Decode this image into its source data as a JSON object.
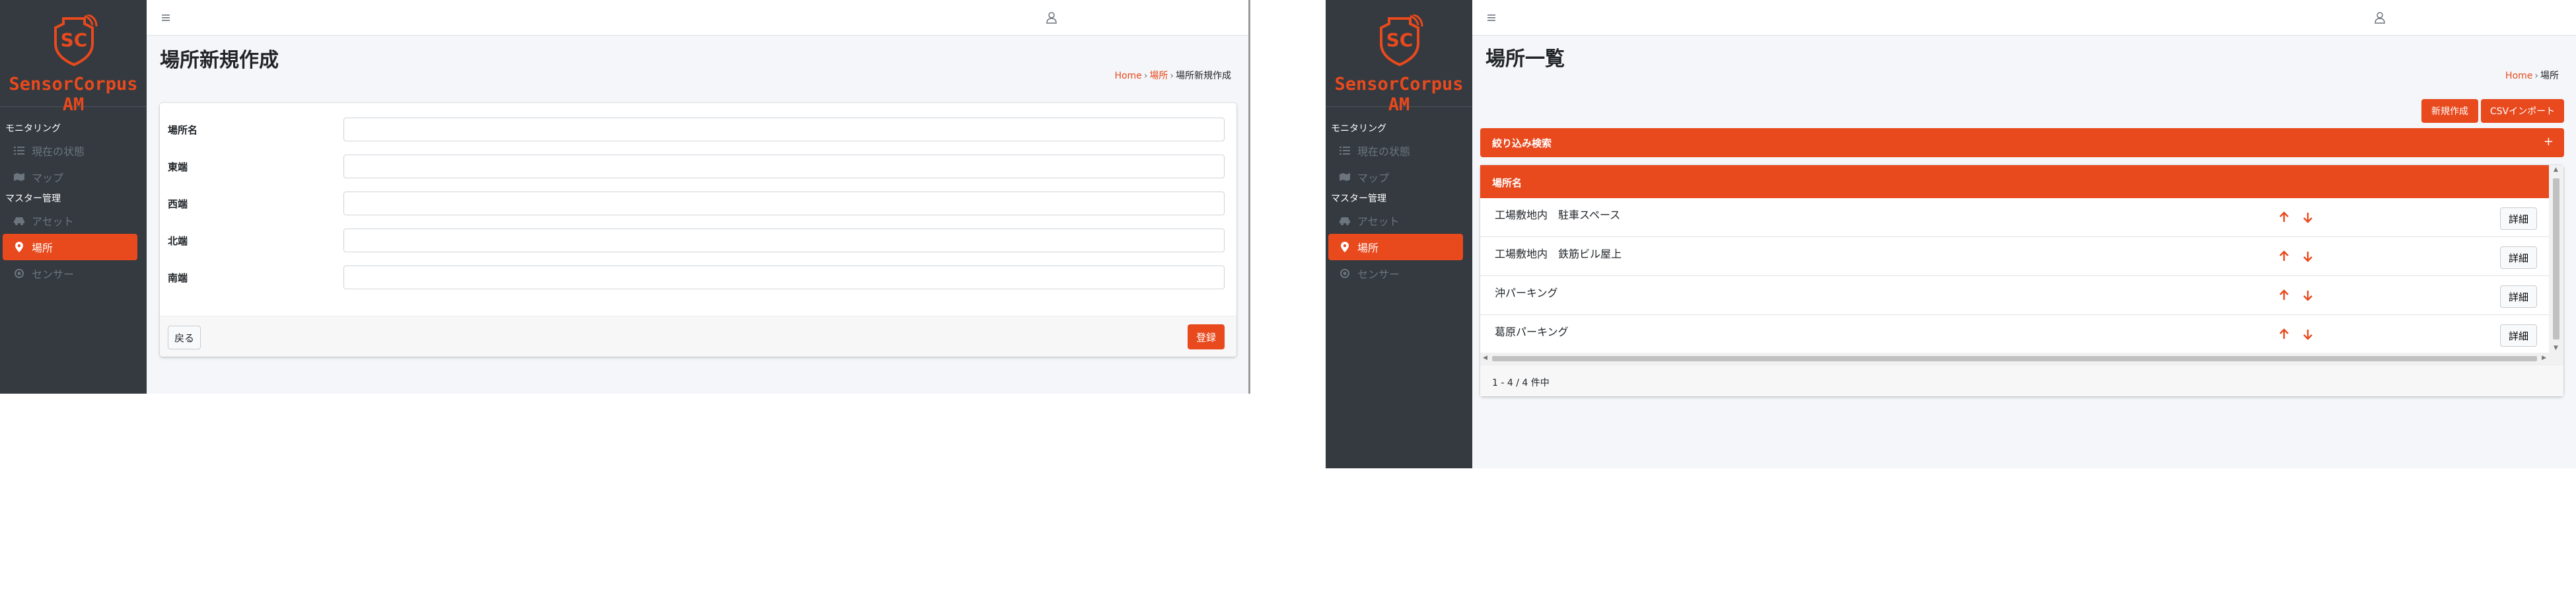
{
  "app": {
    "brand_initials": "SC",
    "brand_name": "SensorCorpus AM"
  },
  "colors": {
    "accent": "#e8491d",
    "sidebar_bg": "#343a40",
    "content_bg": "#f4f6f9"
  },
  "sidebar": {
    "sections": [
      {
        "header": "モニタリング",
        "items": [
          {
            "label": "現在の状態",
            "icon": "list-icon"
          },
          {
            "label": "マップ",
            "icon": "map-icon"
          }
        ]
      },
      {
        "header": "マスター管理",
        "items": [
          {
            "label": "アセット",
            "icon": "car-icon"
          },
          {
            "label": "場所",
            "icon": "location-pin-icon",
            "active": true
          },
          {
            "label": "センサー",
            "icon": "sensor-icon"
          }
        ]
      }
    ]
  },
  "topbar": {
    "menu_icon": "hamburger-icon",
    "user_icon": "user-icon"
  },
  "create_page": {
    "title": "場所新規作成",
    "breadcrumb": [
      "Home",
      "場所",
      "場所新規作成"
    ],
    "fields": [
      {
        "label": "場所名",
        "value": ""
      },
      {
        "label": "東端",
        "value": ""
      },
      {
        "label": "西端",
        "value": ""
      },
      {
        "label": "北端",
        "value": ""
      },
      {
        "label": "南端",
        "value": ""
      }
    ],
    "back_label": "戻る",
    "submit_label": "登録"
  },
  "list_page": {
    "title": "場所一覧",
    "breadcrumb": [
      "Home",
      "場所"
    ],
    "new_button": "新規作成",
    "import_button": "CSVインポート",
    "filter_title": "絞り込み検索",
    "filter_toggle": "+",
    "column_header": "場所名",
    "rows": [
      {
        "name": "工場敷地内　駐車スペース",
        "detail": "詳細"
      },
      {
        "name": "工場敷地内　鉄筋ビル屋上",
        "detail": "詳細"
      },
      {
        "name": "沖パーキング",
        "detail": "詳細"
      },
      {
        "name": "葛原パーキング",
        "detail": "詳細"
      }
    ],
    "pagination": "1 - 4 / 4 件中"
  }
}
